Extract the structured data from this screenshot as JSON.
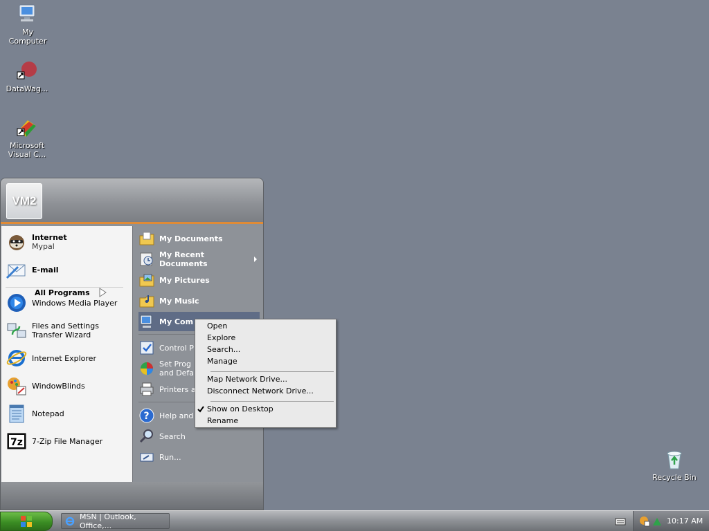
{
  "desktop": {
    "icons": [
      {
        "label": "My\nComputer",
        "icon": "my-computer-icon"
      },
      {
        "label": "DataWag...",
        "icon": "datawag-shortcut-icon"
      },
      {
        "label": "Microsoft\nVisual C...",
        "icon": "visual-c-shortcut-icon"
      },
      {
        "label": "Recycle Bin",
        "icon": "recycle-bin-icon"
      }
    ]
  },
  "start_menu": {
    "user_name": "VM2",
    "pinned": [
      {
        "title": "Internet",
        "subtitle": "Mypal",
        "icon": "mypal-icon"
      },
      {
        "title": "E-mail",
        "icon": "email-icon"
      }
    ],
    "recent": [
      {
        "label": "Windows Media Player",
        "icon": "windows-media-player-icon"
      },
      {
        "label": "Files and Settings Transfer Wizard",
        "line1": "Files and Settings",
        "line2": "Transfer Wizard",
        "icon": "transfer-wizard-icon"
      },
      {
        "label": "Internet Explorer",
        "icon": "internet-explorer-icon"
      },
      {
        "label": "WindowBlinds",
        "icon": "windowblinds-icon"
      },
      {
        "label": "Notepad",
        "icon": "notepad-icon"
      },
      {
        "label": "7-Zip File Manager",
        "icon": "7zip-icon"
      }
    ],
    "all_programs": "All Programs",
    "places": [
      {
        "label": "My Documents",
        "icon": "my-documents-icon"
      },
      {
        "line1": "My Recent",
        "line2": "Documents",
        "icon": "recent-documents-icon"
      },
      {
        "label": "My Pictures",
        "icon": "my-pictures-icon"
      },
      {
        "label": "My Music",
        "icon": "my-music-icon"
      },
      {
        "label": "My Com",
        "icon": "my-computer-icon"
      }
    ],
    "system": [
      {
        "label": "Control P",
        "icon": "control-panel-icon"
      },
      {
        "line1": "Set Prog",
        "line2": "and Defa",
        "icon": "set-program-defaults-icon"
      },
      {
        "label": "Printers a",
        "icon": "printers-icon"
      },
      {
        "label": "Help and",
        "icon": "help-icon"
      },
      {
        "label": "Search",
        "icon": "search-icon"
      },
      {
        "label": "Run...",
        "icon": "run-icon"
      }
    ]
  },
  "context_menu": {
    "items": [
      "Open",
      "Explore",
      "Search...",
      "Manage",
      "Map Network Drive...",
      "Disconnect Network Drive...",
      "Show on Desktop",
      "Rename"
    ],
    "checked": "Show on Desktop"
  },
  "taskbar": {
    "task_label": "MSN | Outlook, Office,...",
    "clock": "10:17 AM"
  },
  "colors": {
    "desktop": "#7a8290",
    "accent": "#e08b36",
    "start_button": "#3b8d24"
  }
}
